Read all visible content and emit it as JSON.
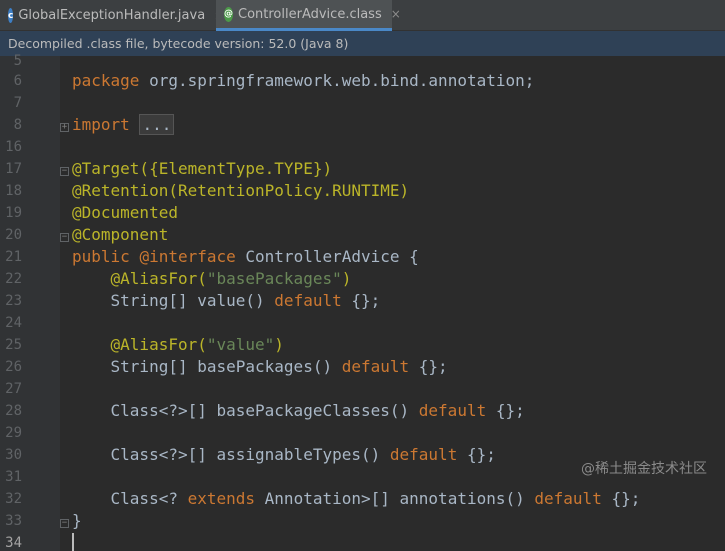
{
  "tabs": [
    {
      "label": "GlobalExceptionHandler.java",
      "icon": "java-class-icon",
      "close": "×"
    },
    {
      "label": "ControllerAdvice.class",
      "icon": "compiled-class-icon",
      "close": "×"
    }
  ],
  "notice": "Decompiled .class file, bytecode version: 52.0 (Java 8)",
  "line_numbers": [
    "5",
    "6",
    "7",
    "8",
    "16",
    "17",
    "18",
    "19",
    "20",
    "21",
    "22",
    "23",
    "24",
    "25",
    "26",
    "27",
    "28",
    "29",
    "30",
    "31",
    "32",
    "33",
    "34"
  ],
  "code": {
    "l6_kw": "package",
    "l6_rest": " org.springframework.web.bind.annotation;",
    "l8_kw": "import",
    "l8_folded": "...",
    "l17": "@Target({ElementType.TYPE})",
    "l18": "@Retention(RetentionPolicy.RUNTIME)",
    "l19": "@Documented",
    "l20": "@Component",
    "l21_kw1": "public",
    "l21_kw2": "@interface",
    "l21_rest": " ControllerAdvice {",
    "l22_ann": "    @AliasFor(",
    "l22_str": "\"basePackages\"",
    "l22_end": ")",
    "l23_a": "    String[] value() ",
    "l23_kw": "default",
    "l23_b": " {};",
    "l25_ann": "    @AliasFor(",
    "l25_str": "\"value\"",
    "l25_end": ")",
    "l26_a": "    String[] basePackages() ",
    "l26_kw": "default",
    "l26_b": " {};",
    "l28_a": "    Class<?>[] basePackageClasses() ",
    "l28_kw": "default",
    "l28_b": " {};",
    "l30_a": "    Class<?>[] assignableTypes() ",
    "l30_kw": "default",
    "l30_b": " {};",
    "l32_a": "    Class<? ",
    "l32_kw": "extends",
    "l32_b": " Annotation>[] annotations() ",
    "l32_kw2": "default",
    "l32_c": " {};",
    "l33": "}"
  },
  "watermark": "@稀土掘金技术社区",
  "colors": {
    "keyword": "#cc7832",
    "annotation": "#bbb529",
    "string": "#6a8759",
    "text": "#a9b7c6",
    "background": "#2b2b2b"
  }
}
